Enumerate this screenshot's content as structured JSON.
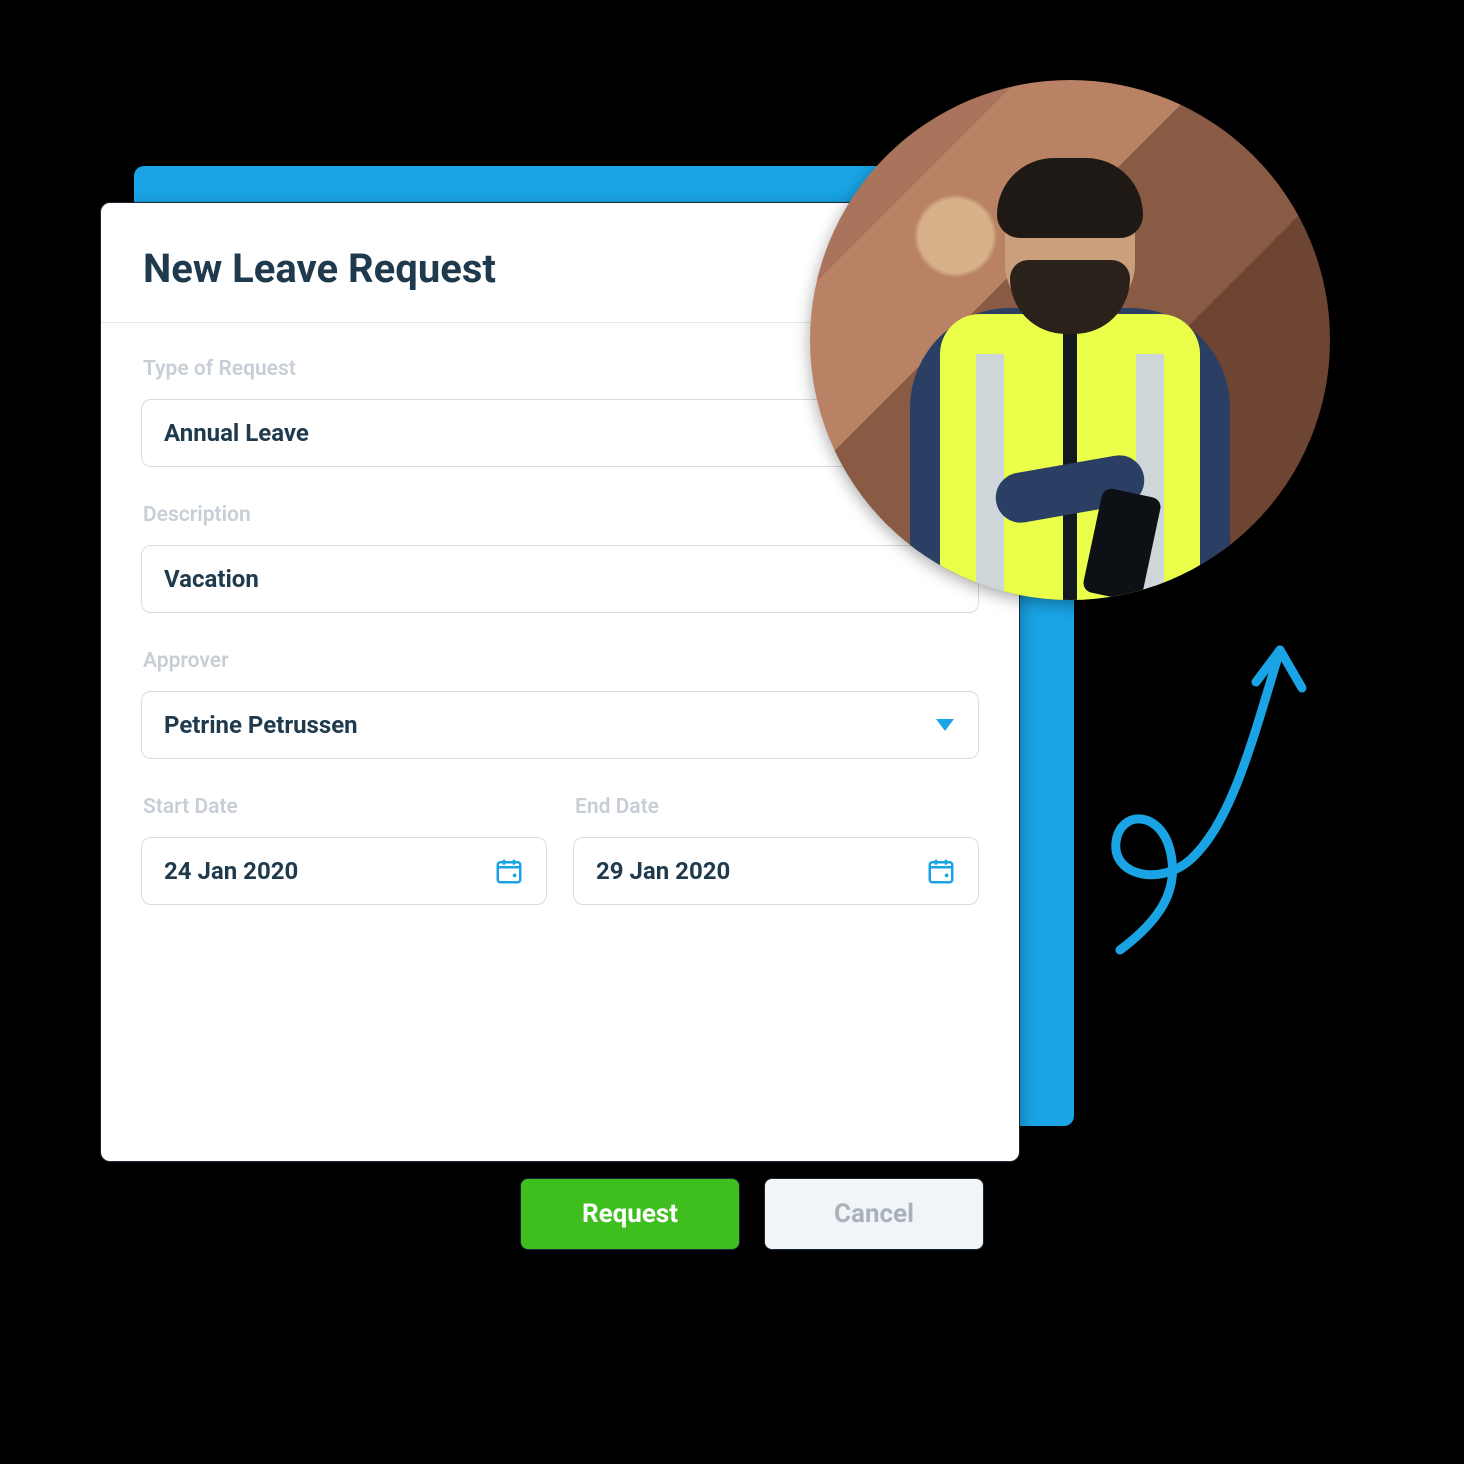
{
  "colors": {
    "accent": "#1aa4e6",
    "primary": "#3fbf1f",
    "text": "#1f3a4d",
    "muted": "#c7ced6"
  },
  "form": {
    "title": "New Leave Request",
    "type_label": "Type of Request",
    "type_value": "Annual Leave",
    "description_label": "Description",
    "description_value": "Vacation",
    "approver_label": "Approver",
    "approver_value": "Petrine Petrussen",
    "start_label": "Start Date",
    "start_value": "24 Jan 2020",
    "end_label": "End Date",
    "end_value": "29 Jan 2020"
  },
  "actions": {
    "request": "Request",
    "cancel": "Cancel"
  }
}
